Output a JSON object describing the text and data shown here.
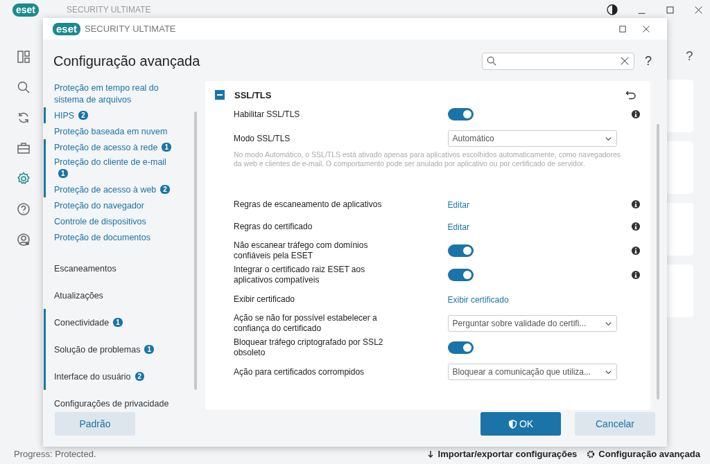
{
  "background": {
    "logo": "eset",
    "product": "SECURITY ULTIMATE",
    "sidebar": [
      {
        "selected": false
      },
      {
        "selected": false
      },
      {
        "selected": false
      },
      {
        "selected": false
      },
      {
        "selected": true
      },
      {
        "selected": false
      },
      {
        "selected": false
      }
    ],
    "status": "Progress: Protected.",
    "footer_links": [
      {
        "label": "Importar/exportar configurações"
      },
      {
        "label": "Configuração avançada"
      }
    ],
    "help": "?"
  },
  "dialog": {
    "logo": "eset",
    "product": "SECURITY ULTIMATE",
    "title": "Configuração avançada",
    "help": "?",
    "nav": [
      {
        "kind": "link",
        "label": "Proteção em tempo real do sistema de arquivos",
        "modified": false
      },
      {
        "kind": "link",
        "label": "HIPS",
        "badge": "2",
        "modified": true
      },
      {
        "kind": "link",
        "label": "Proteção baseada em nuvem",
        "modified": false
      },
      {
        "kind": "link",
        "label": "Proteção de acesso à rede",
        "badge": "1",
        "modified": true
      },
      {
        "kind": "link",
        "label": "Proteção do cliente de e-mail",
        "badge": "1",
        "modified": true
      },
      {
        "kind": "link",
        "label": "Proteção de acesso à web",
        "badge": "2",
        "modified": true
      },
      {
        "kind": "link",
        "label": "Proteção do navegador",
        "modified": false
      },
      {
        "kind": "link",
        "label": "Controle de dispositivos",
        "modified": false
      },
      {
        "kind": "link",
        "label": "Proteção de documentos",
        "modified": false
      },
      {
        "kind": "section",
        "label": "Escaneamentos",
        "modified": false
      },
      {
        "kind": "section",
        "label": "Atualizações",
        "modified": false
      },
      {
        "kind": "section",
        "label": "Conectividade",
        "badge": "1",
        "modified": true
      },
      {
        "kind": "section",
        "label": "Solução de problemas",
        "badge": "1",
        "modified": true
      },
      {
        "kind": "section",
        "label": "Interface do usuário",
        "badge": "2",
        "modified": true
      },
      {
        "kind": "section",
        "label": "Configurações de privacidade",
        "modified": false
      }
    ],
    "section": {
      "title": "SSL/TLS",
      "expanded": true,
      "rows": [
        {
          "kind": "toggle",
          "label": "Habilitar SSL/TLS",
          "on": true,
          "info": true
        },
        {
          "kind": "select",
          "label": "Modo SSL/TLS",
          "value": "Automático",
          "info": false,
          "description": "No modo Automático, o SSL/TLS está ativado apenas para aplicativos escolhidos automaticamente, como navegadores da web e clientes de e-mail. O comportamento pode ser anulado por aplicativo ou por certificado de servidor."
        },
        {
          "kind": "link",
          "label": "Regras de escaneamento de aplicativos",
          "value": "Editar",
          "info": true
        },
        {
          "kind": "link",
          "label": "Regras do certificado",
          "value": "Editar",
          "info": true
        },
        {
          "kind": "toggle",
          "label": "Não escanear tráfego com domínios confiáveis pela ESET",
          "on": true,
          "info": true
        },
        {
          "kind": "toggle",
          "label": "Integrar o certificado raiz ESET aos aplicativos compatíveis",
          "on": true,
          "info": true
        },
        {
          "kind": "link",
          "label": "Exibir certificado",
          "value": "Exibir certificado",
          "info": false
        },
        {
          "kind": "select",
          "label": "Ação se não for possível estabelecer a confiança do certificado",
          "value": "Perguntar sobre validade do certifi...",
          "info": false
        },
        {
          "kind": "toggle",
          "label": "Bloquear tráfego criptografado por SSL2 obsoleto",
          "on": true,
          "info": false
        },
        {
          "kind": "select",
          "label": "Ação para certificados corrompidos",
          "value": "Bloquear a comunicação que utiliza...",
          "info": false
        }
      ]
    },
    "buttons": [
      {
        "kind": "secondary",
        "label": "Padrão"
      },
      {
        "kind": "primary",
        "label": "OK"
      },
      {
        "kind": "secondary",
        "label": "Cancelar"
      }
    ]
  }
}
